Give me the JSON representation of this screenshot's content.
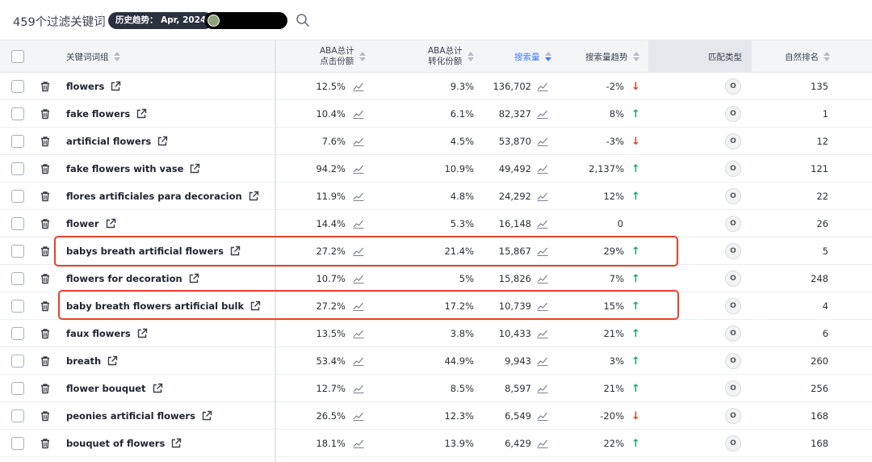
{
  "header": {
    "count_label": "459个过滤关键词",
    "trend_label": "历史趋势：  Apr, 2024"
  },
  "columns": {
    "keyword": "关键词词组",
    "aba_click_l1": "ABA总计",
    "aba_click_l2": "点击份额",
    "aba_conv_l1": "ABA总计",
    "aba_conv_l2": "转化份额",
    "search_volume": "搜索量",
    "volume_trend": "搜索量趋势",
    "match_type": "匹配类型",
    "organic_rank": "自然排名"
  },
  "rows": [
    {
      "keyword": "flowers",
      "click_share": "12.5%",
      "conv_share": "9.3%",
      "volume": "136,702",
      "trend": "-2%",
      "dir": "down",
      "match": "O",
      "rank": "135"
    },
    {
      "keyword": "fake flowers",
      "click_share": "10.4%",
      "conv_share": "6.1%",
      "volume": "82,327",
      "trend": "8%",
      "dir": "up",
      "match": "O",
      "rank": "1"
    },
    {
      "keyword": "artificial flowers",
      "click_share": "7.6%",
      "conv_share": "4.5%",
      "volume": "53,870",
      "trend": "-3%",
      "dir": "down",
      "match": "O",
      "rank": "12"
    },
    {
      "keyword": "fake flowers with vase",
      "click_share": "94.2%",
      "conv_share": "10.9%",
      "volume": "49,492",
      "trend": "2,137%",
      "dir": "up",
      "match": "O",
      "rank": "121"
    },
    {
      "keyword": "flores artificiales para decoracion",
      "click_share": "11.9%",
      "conv_share": "4.8%",
      "volume": "24,292",
      "trend": "12%",
      "dir": "up",
      "match": "O",
      "rank": "22"
    },
    {
      "keyword": "flower",
      "click_share": "14.4%",
      "conv_share": "5.3%",
      "volume": "16,148",
      "trend": "0",
      "dir": "none",
      "match": "O",
      "rank": "26"
    },
    {
      "keyword": "babys breath artificial flowers",
      "click_share": "27.2%",
      "conv_share": "21.4%",
      "volume": "15,867",
      "trend": "29%",
      "dir": "up",
      "match": "O",
      "rank": "5"
    },
    {
      "keyword": "flowers for decoration",
      "click_share": "10.7%",
      "conv_share": "5%",
      "volume": "15,826",
      "trend": "7%",
      "dir": "up",
      "match": "O",
      "rank": "248"
    },
    {
      "keyword": "baby breath flowers artificial bulk",
      "click_share": "27.2%",
      "conv_share": "17.2%",
      "volume": "10,739",
      "trend": "15%",
      "dir": "up",
      "match": "O",
      "rank": "4"
    },
    {
      "keyword": "faux flowers",
      "click_share": "13.5%",
      "conv_share": "3.8%",
      "volume": "10,433",
      "trend": "21%",
      "dir": "up",
      "match": "O",
      "rank": "6"
    },
    {
      "keyword": "breath",
      "click_share": "53.4%",
      "conv_share": "44.9%",
      "volume": "9,943",
      "trend": "3%",
      "dir": "up",
      "match": "O",
      "rank": "260"
    },
    {
      "keyword": "flower bouquet",
      "click_share": "12.7%",
      "conv_share": "8.5%",
      "volume": "8,597",
      "trend": "21%",
      "dir": "up",
      "match": "O",
      "rank": "256"
    },
    {
      "keyword": "peonies artificial flowers",
      "click_share": "26.5%",
      "conv_share": "12.3%",
      "volume": "6,549",
      "trend": "-20%",
      "dir": "down",
      "match": "O",
      "rank": "168"
    },
    {
      "keyword": "bouquet of flowers",
      "click_share": "18.1%",
      "conv_share": "13.9%",
      "volume": "6,429",
      "trend": "22%",
      "dir": "up",
      "match": "O",
      "rank": "168"
    }
  ],
  "colors": {
    "accent": "#3d7bff",
    "up": "#1fa86a",
    "down": "#e0402a",
    "highlight": "#e8412a"
  }
}
